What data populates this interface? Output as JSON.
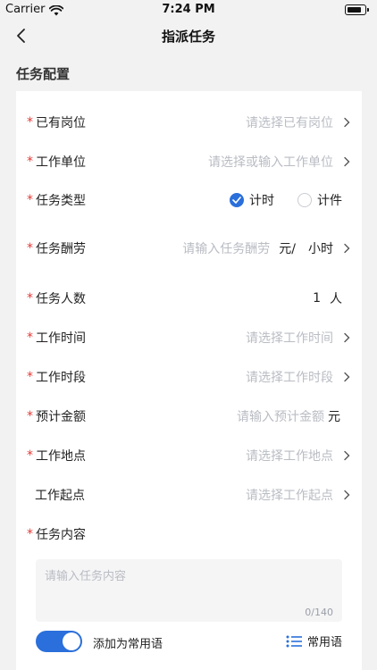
{
  "status_bar": {
    "carrier": "Carrier",
    "time": "7:24 PM"
  },
  "nav": {
    "title": "指派任务"
  },
  "section": {
    "title": "任务配置"
  },
  "form": {
    "required_mark": "*",
    "post": {
      "label": "已有岗位",
      "placeholder": "请选择已有岗位"
    },
    "unit": {
      "label": "工作单位",
      "placeholder": "请选择或输入工作单位"
    },
    "task_type": {
      "label": "任务类型",
      "option_time": "计时",
      "option_piece": "计件",
      "selected": "计时"
    },
    "pay": {
      "label": "任务酬劳",
      "placeholder": "请输入任务酬劳",
      "unit_currency": "元/",
      "unit_period": "小时"
    },
    "headcount": {
      "label": "任务人数",
      "value": "1",
      "unit": "人"
    },
    "work_time": {
      "label": "工作时间",
      "placeholder": "请选择工作时间"
    },
    "time_slot": {
      "label": "工作时段",
      "placeholder": "请选择工作时段"
    },
    "estimate": {
      "label": "预计金额",
      "placeholder": "请输入预计金额",
      "unit": "元"
    },
    "location": {
      "label": "工作地点",
      "placeholder": "请选择工作地点"
    },
    "start_point": {
      "label": "工作起点",
      "placeholder": "请选择工作起点"
    },
    "content": {
      "label": "任务内容",
      "placeholder": "请输入任务内容",
      "counter": "0/140"
    }
  },
  "bottom": {
    "toggle_label": "添加为常用语",
    "toggle_on": true,
    "phrases_label": "常用语"
  },
  "colors": {
    "accent": "#2a6fdb",
    "required": "#e53935",
    "placeholder": "#b9bcc3"
  }
}
